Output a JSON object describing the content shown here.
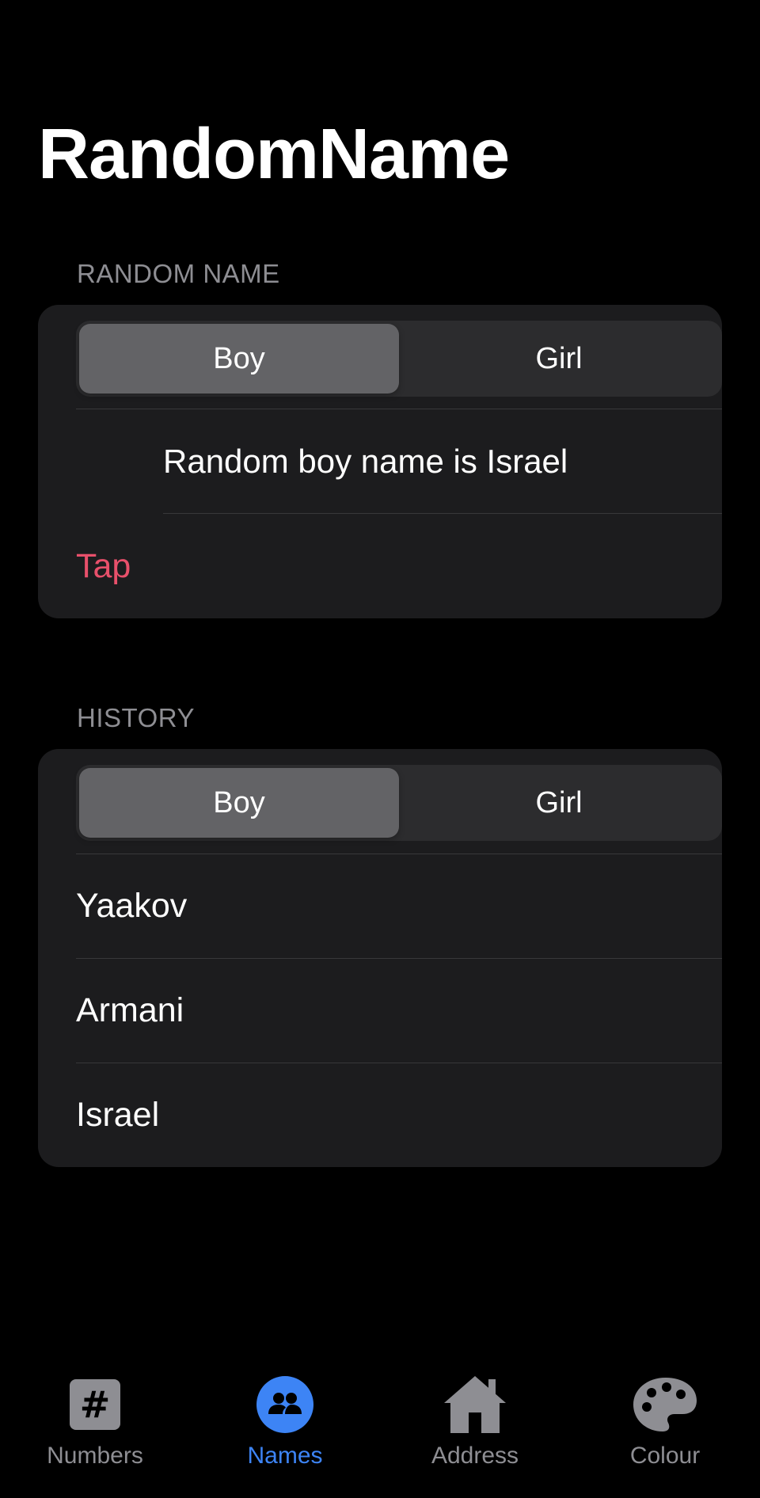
{
  "title": "RandomName",
  "random_section": {
    "header": "RANDOM NAME",
    "segments": [
      "Boy",
      "Girl"
    ],
    "selected": "Boy",
    "result_text": "Random boy name is Israel",
    "tap_label": "Tap"
  },
  "history_section": {
    "header": "HISTORY",
    "segments": [
      "Boy",
      "Girl"
    ],
    "selected": "Boy",
    "items": [
      "Yaakov",
      "Armani",
      "Israel"
    ]
  },
  "tab_bar": {
    "tabs": [
      {
        "label": "Numbers",
        "icon": "number-square-icon",
        "active": false
      },
      {
        "label": "Names",
        "icon": "people-circle-icon",
        "active": true
      },
      {
        "label": "Address",
        "icon": "house-icon",
        "active": false
      },
      {
        "label": "Colour",
        "icon": "palette-icon",
        "active": false
      }
    ]
  },
  "colors": {
    "background": "#000000",
    "card": "#1c1c1e",
    "accent": "#3d84f5",
    "tap": "#e8506b",
    "secondary_text": "#8e8e93"
  }
}
